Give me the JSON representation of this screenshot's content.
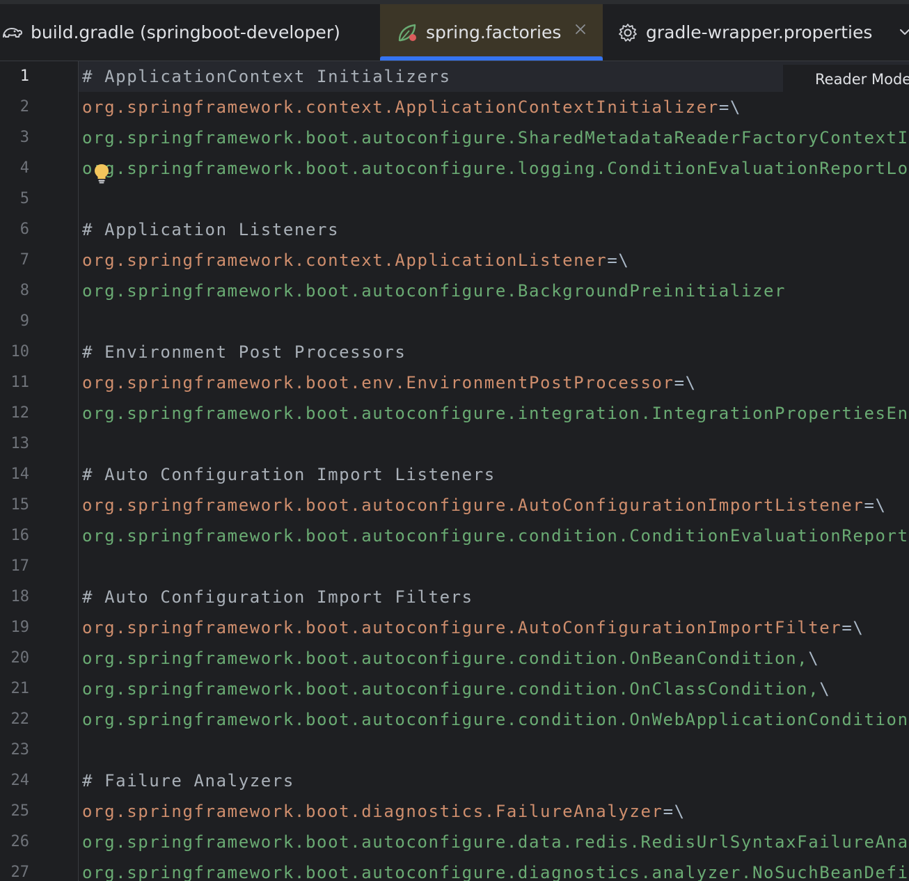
{
  "tabs": [
    {
      "label": "build.gradle (springboot-developer)",
      "icon": "gradle-elephant-icon"
    },
    {
      "label": "spring.factories",
      "icon": "spring-leaf-icon",
      "active": true
    },
    {
      "label": "gradle-wrapper.properties",
      "icon": "gear-icon"
    }
  ],
  "editor": {
    "reader_mode_label": "Reader Mode",
    "current_line": 1,
    "line_numbers": [
      "1",
      "2",
      "3",
      "4",
      "5",
      "6",
      "7",
      "8",
      "9",
      "10",
      "11",
      "12",
      "13",
      "14",
      "15",
      "16",
      "17",
      "18",
      "19",
      "20",
      "21",
      "22",
      "23",
      "24",
      "25",
      "26",
      "27"
    ],
    "lines": [
      {
        "type": "comment",
        "text": "# ApplicationContext Initializers"
      },
      {
        "type": "key",
        "key": "org.springframework.context.ApplicationContextInitializer",
        "sep": "=\\"
      },
      {
        "type": "value",
        "text": "org.springframework.boot.autoconfigure.SharedMetadataReaderFactoryContextInit"
      },
      {
        "type": "value",
        "text": "org.springframework.boot.autoconfigure.logging.ConditionEvaluationReportLogg"
      },
      {
        "type": "blank",
        "text": ""
      },
      {
        "type": "comment",
        "text": "# Application Listeners"
      },
      {
        "type": "key",
        "key": "org.springframework.context.ApplicationListener",
        "sep": "=\\"
      },
      {
        "type": "value",
        "text": "org.springframework.boot.autoconfigure.BackgroundPreinitializer"
      },
      {
        "type": "blank",
        "text": ""
      },
      {
        "type": "comment",
        "text": "# Environment Post Processors"
      },
      {
        "type": "key",
        "key": "org.springframework.boot.env.EnvironmentPostProcessor",
        "sep": "=\\"
      },
      {
        "type": "value",
        "text": "org.springframework.boot.autoconfigure.integration.IntegrationPropertiesEnvi"
      },
      {
        "type": "blank",
        "text": ""
      },
      {
        "type": "comment",
        "text": "# Auto Configuration Import Listeners"
      },
      {
        "type": "key",
        "key": "org.springframework.boot.autoconfigure.AutoConfigurationImportListener",
        "sep": "=\\"
      },
      {
        "type": "value",
        "text": "org.springframework.boot.autoconfigure.condition.ConditionEvaluationReportAu"
      },
      {
        "type": "blank",
        "text": ""
      },
      {
        "type": "comment",
        "text": "# Auto Configuration Import Filters"
      },
      {
        "type": "key",
        "key": "org.springframework.boot.autoconfigure.AutoConfigurationImportFilter",
        "sep": "=\\"
      },
      {
        "type": "value",
        "text": "org.springframework.boot.autoconfigure.condition.OnBeanCondition,",
        "sep": "\\"
      },
      {
        "type": "value",
        "text": "org.springframework.boot.autoconfigure.condition.OnClassCondition,",
        "sep": "\\"
      },
      {
        "type": "value",
        "text": "org.springframework.boot.autoconfigure.condition.OnWebApplicationCondition"
      },
      {
        "type": "blank",
        "text": ""
      },
      {
        "type": "comment",
        "text": "# Failure Analyzers"
      },
      {
        "type": "key",
        "key": "org.springframework.boot.diagnostics.FailureAnalyzer",
        "sep": "=\\"
      },
      {
        "type": "value",
        "text": "org.springframework.boot.autoconfigure.data.redis.RedisUrlSyntaxFailureAnaly"
      },
      {
        "type": "value",
        "text": "org.springframework.boot.autoconfigure.diagnostics.analyzer.NoSuchBeanDefini"
      }
    ]
  },
  "colors": {
    "background": "#1e1f22",
    "active_tab": "#3c3627",
    "tab_underline": "#3574f0",
    "comment": "#a9b0b8",
    "key": "#cf8e6d",
    "value": "#6aab73",
    "line_number": "#6f737a"
  }
}
